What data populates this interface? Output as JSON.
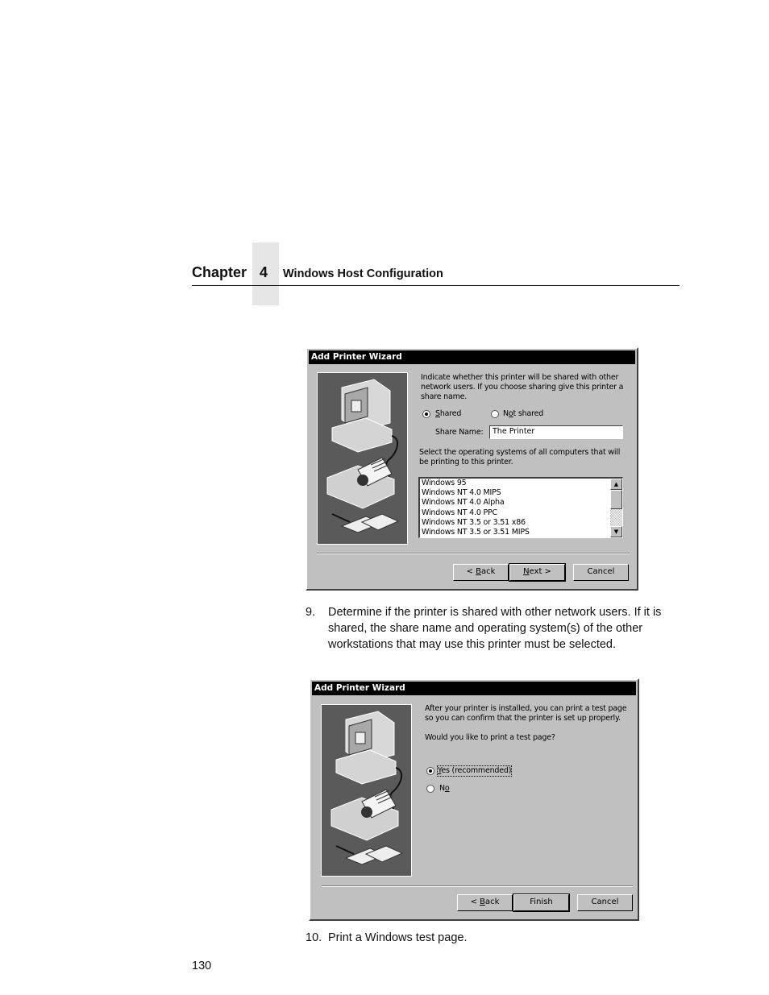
{
  "header": {
    "chapter_word": "Chapter",
    "chapter_number": "4",
    "chapter_title": "Windows Host Configuration"
  },
  "dialog1": {
    "title": "Add Printer Wizard",
    "intro": "Indicate whether this printer will be shared with other network users.  If you choose sharing give this printer a share name.",
    "radio_shared": "Shared",
    "radio_not_shared": "Not shared",
    "selected": "Shared",
    "share_name_label": "Share Name:",
    "share_name_value": "The Printer",
    "os_prompt": "Select the operating systems of all computers that will be printing to this printer.",
    "os_list": [
      "Windows 95",
      "Windows NT 4.0 MIPS",
      "Windows NT 4.0 Alpha",
      "Windows NT 4.0 PPC",
      "Windows NT 3.5 or 3.51 x86",
      "Windows NT 3.5 or 3.51 MIPS"
    ],
    "buttons": {
      "back": "< Back",
      "next": "Next >",
      "cancel": "Cancel"
    }
  },
  "step9": {
    "number": "9.",
    "text": "Determine if the printer is shared with other network users. If it is shared, the share name and operating system(s) of the other workstations that may use this printer must be selected."
  },
  "dialog2": {
    "title": "Add Printer Wizard",
    "intro": "After your printer is installed, you can print a test page so you can confirm that the printer is set up properly.",
    "question": "Would you like to print a test page?",
    "radio_yes": "Yes (recommended)",
    "radio_no": "No",
    "selected": "Yes (recommended)",
    "buttons": {
      "back": "< Back",
      "finish": "Finish",
      "cancel": "Cancel"
    }
  },
  "step10": {
    "number": "10.",
    "text": "Print a Windows test page."
  },
  "footer": {
    "page_number": "130"
  }
}
